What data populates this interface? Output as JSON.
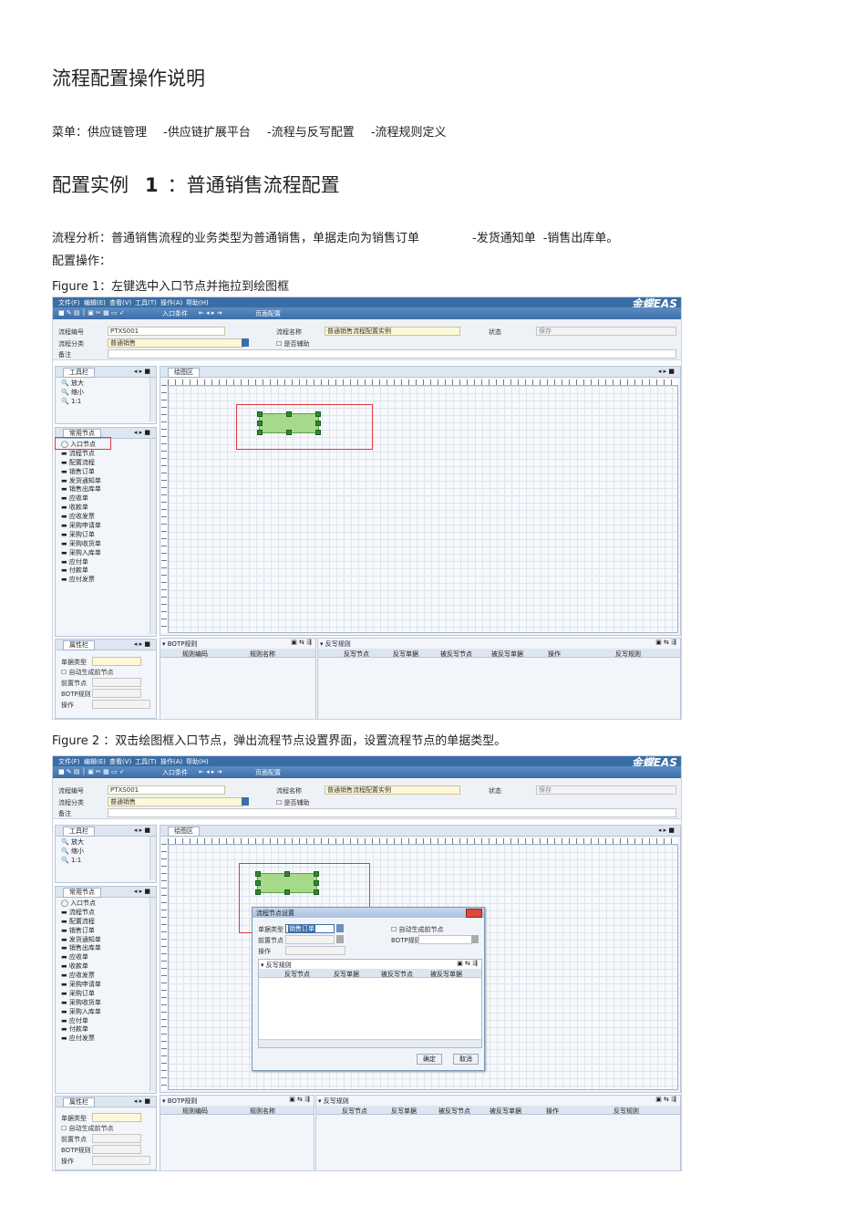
{
  "title": "流程配置操作说明",
  "menu_path": [
    "菜单：供应链管理",
    "-供应链扩展平台",
    "-流程与反写配置",
    "-流程规则定义"
  ],
  "example_heading": {
    "prefix": "配置实例",
    "number": "1",
    "rest": "：普通销售流程配置"
  },
  "analysis": {
    "part1": "流程分析：普通销售流程的业务类型为普通销售，单据走向为销售订单",
    "part2": "-发货通知单",
    "part3": "-销售出库单。"
  },
  "config_ops": "配置操作：",
  "figure1_caption": "Figure 1：左键选中入口节点并拖拉到绘图框",
  "figure2_caption": "Figure 2 ：双击绘图框入口节点，弹出流程节点设置界面，设置流程节点的单据类型。",
  "app": {
    "menus": [
      "文件(F)",
      "编辑(E)",
      "查看(V)",
      "工具(T)",
      "操作(A)",
      "帮助(H)"
    ],
    "logo": "金蝶EAS",
    "toolbar": [
      "入口条件",
      "页面配置"
    ],
    "header": {
      "code_label": "流程编号",
      "code_value": "PTXS001",
      "name_label": "流程名称",
      "name_value": "普通销售流程配置实例",
      "status_label": "状态",
      "status_value": "保存",
      "category_label": "流程分类",
      "category_value": "普通销售",
      "aux_label": "是否辅助",
      "remark_label": "备注"
    },
    "toolbox": {
      "title": "工具栏",
      "items": [
        "放大",
        "缩小",
        "1:1"
      ]
    },
    "canvas_tab": "绘图区",
    "nodes_panel": {
      "title": "常用节点",
      "items": [
        "入口节点",
        "流程节点",
        "配置流程",
        "销售订单",
        "发货通知单",
        "销售出库单",
        "应收单",
        "收款单",
        "应收发票",
        "采购申请单",
        "采购订单",
        "采购收货单",
        "采购入库单",
        "应付单",
        "付款单",
        "应付发票"
      ]
    },
    "props_panel": {
      "title": "属性栏",
      "items": [
        "单据类型",
        "自动生成前节点",
        "前置节点",
        "BOTP规则",
        "操作"
      ]
    },
    "botp": {
      "title": "BOTP规则",
      "cols": [
        "规则编码",
        "规则名称"
      ]
    },
    "writeback": {
      "title": "反写规则",
      "cols": [
        "反写节点",
        "反写单据",
        "被反写节点",
        "被反写单据",
        "操作",
        "反写规则"
      ]
    },
    "dialog": {
      "title": "流程节点设置",
      "doc_type_label": "单据类型",
      "doc_type_value": "销售订单",
      "auto_gen_label": "自动生成前节点",
      "pre_node_label": "前置节点",
      "botp_label": "BOTP规则",
      "op_label": "操作",
      "wb_title": "反写规则",
      "wb_cols": [
        "反写节点",
        "反写单据",
        "被反写节点",
        "被反写单据"
      ],
      "ok": "确定",
      "cancel": "取消"
    }
  }
}
